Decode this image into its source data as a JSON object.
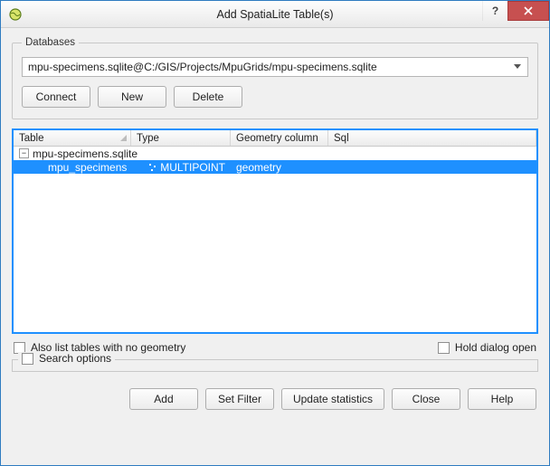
{
  "window": {
    "title": "Add SpatiaLite Table(s)"
  },
  "databases": {
    "legend": "Databases",
    "selected": "mpu-specimens.sqlite@C:/GIS/Projects/MpuGrids/mpu-specimens.sqlite",
    "connect": "Connect",
    "new": "New",
    "delete": "Delete"
  },
  "columns": {
    "table": "Table",
    "type": "Type",
    "geom": "Geometry column",
    "sql": "Sql"
  },
  "tree": {
    "db_name": "mpu-specimens.sqlite",
    "row": {
      "name": "mpu_specimens",
      "type": "MULTIPOINT",
      "geom": "geometry",
      "sql": ""
    }
  },
  "options": {
    "also_list": "Also list tables with no geometry",
    "hold_open": "Hold dialog open",
    "search": "Search options"
  },
  "buttons": {
    "add": "Add",
    "set_filter": "Set Filter",
    "update_stats": "Update statistics",
    "close": "Close",
    "help": "Help"
  }
}
